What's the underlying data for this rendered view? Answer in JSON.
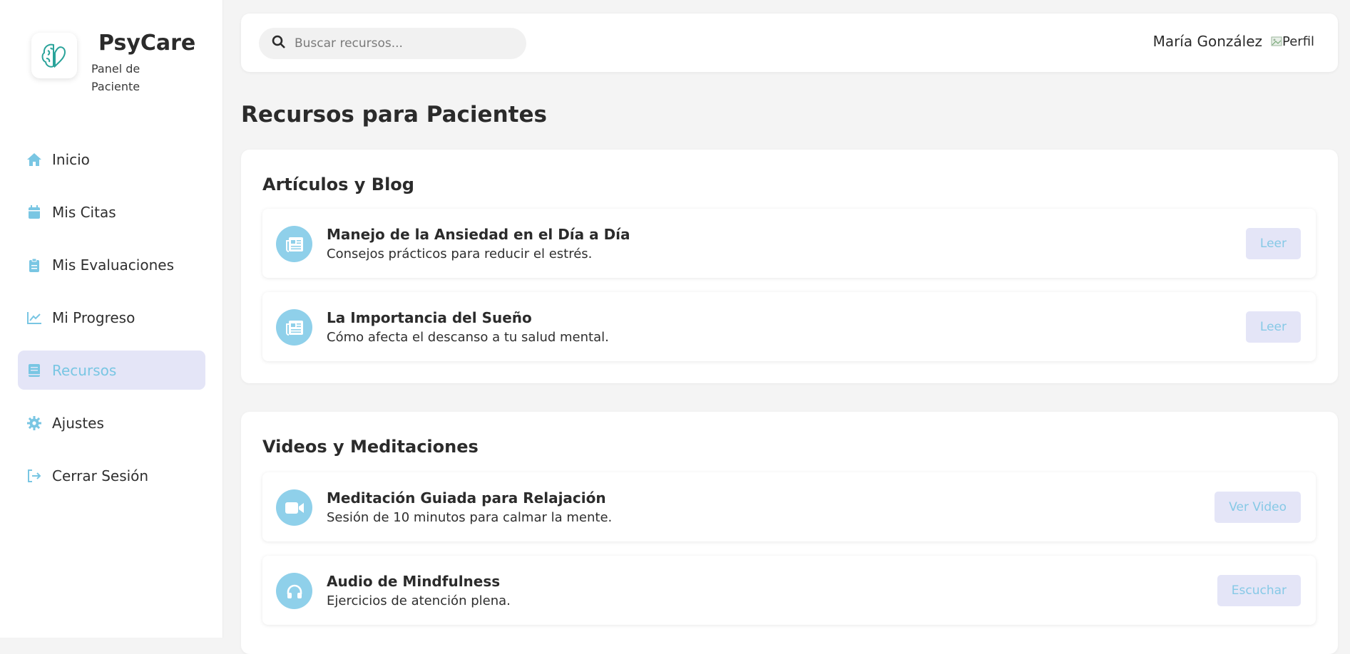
{
  "brand": {
    "name": "PsyCare",
    "subtitle": "Panel de Paciente"
  },
  "sidebar": {
    "items": [
      {
        "label": "Inicio",
        "icon": "home-icon"
      },
      {
        "label": "Mis Citas",
        "icon": "calendar-icon"
      },
      {
        "label": "Mis Evaluaciones",
        "icon": "clipboard-icon"
      },
      {
        "label": "Mi Progreso",
        "icon": "chart-line-icon"
      },
      {
        "label": "Recursos",
        "icon": "book-icon",
        "active": true
      },
      {
        "label": "Ajustes",
        "icon": "gear-icon"
      },
      {
        "label": "Cerrar Sesión",
        "icon": "sign-out-icon"
      }
    ]
  },
  "topbar": {
    "search_placeholder": "Buscar recursos...",
    "user_name": "María González",
    "avatar_alt": "Perfil"
  },
  "main": {
    "title": "Recursos para Pacientes",
    "sections": [
      {
        "heading": "Artículos y Blog",
        "items": [
          {
            "title": "Manejo de la Ansiedad en el Día a Día",
            "desc": "Consejos prácticos para reducir el estrés.",
            "button": "Leer",
            "icon": "newspaper-icon"
          },
          {
            "title": "La Importancia del Sueño",
            "desc": "Cómo afecta el descanso a tu salud mental.",
            "button": "Leer",
            "icon": "newspaper-icon"
          }
        ]
      },
      {
        "heading": "Videos y Meditaciones",
        "items": [
          {
            "title": "Meditación Guiada para Relajación",
            "desc": "Sesión de 10 minutos para calmar la mente.",
            "button": "Ver Video",
            "icon": "video-icon"
          },
          {
            "title": "Audio de Mindfulness",
            "desc": "Ejercicios de atención plena.",
            "button": "Escuchar",
            "icon": "headphones-icon"
          }
        ]
      }
    ]
  },
  "colors": {
    "accent": "#79c6e3",
    "active_bg": "#e4e5f7",
    "icon_circle": "#8fd0ea"
  }
}
